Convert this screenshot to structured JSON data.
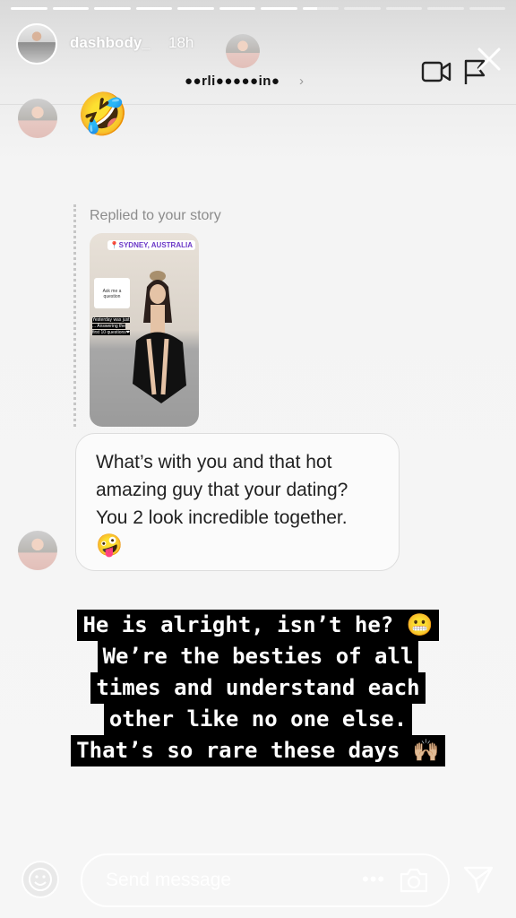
{
  "progress": {
    "segments": [
      1,
      1,
      1,
      1,
      1,
      1,
      1,
      0.4,
      0,
      0,
      0,
      0
    ]
  },
  "header": {
    "owner_name": "dashbody_",
    "timestamp": "18h",
    "recipient_name": "●●rli●●●●●in●",
    "chevron": "›"
  },
  "chat": {
    "reaction_emoji": "🤣",
    "reply_label": "Replied to your story",
    "story_thumbnail": {
      "location_sticker": "📍SYDNEY, AUSTRALIA",
      "question_card": "Ask me a question",
      "overlay_text": "Yesterday was just ... Answering the first 10 questions❤"
    },
    "message": "What’s with you and that hot\namazing guy that your dating?\nYou 2 look incredible together.",
    "message_emoji": "🤪"
  },
  "caption": {
    "lines": [
      "He is alright, isn’t he? 😬",
      "We’re the besties of all",
      "times and understand each",
      "other like no one else.",
      "That’s so rare these days 🙌🏼"
    ]
  },
  "composer": {
    "placeholder": "Send message",
    "more": "•••"
  },
  "icons": {
    "video": "video-camera",
    "flag": "flag",
    "close": "close",
    "camera": "camera",
    "send": "paper-plane",
    "smiley": "smiley-face"
  }
}
